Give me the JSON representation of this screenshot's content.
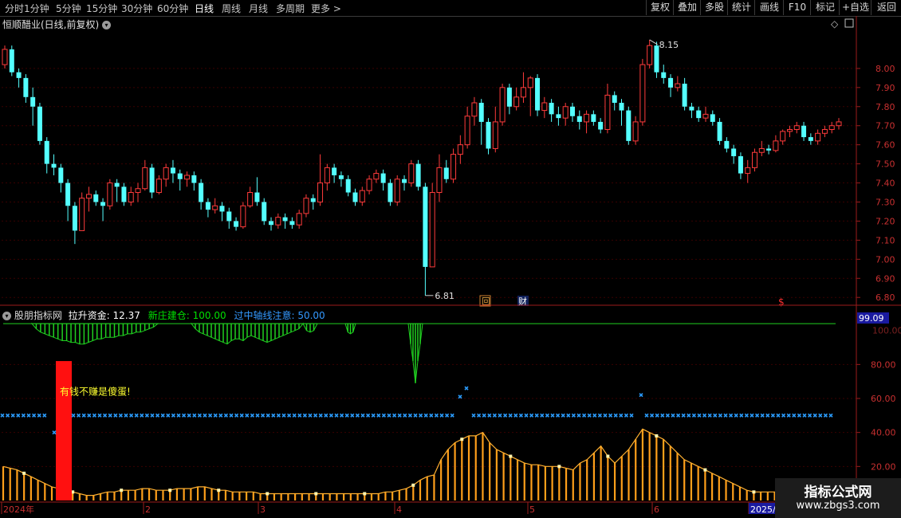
{
  "toolbar": {
    "periods": [
      "分时",
      "1分钟",
      "5分钟",
      "15分钟",
      "30分钟",
      "60分钟",
      "日线",
      "周线",
      "月线",
      "多周期",
      "更多"
    ],
    "active_period": "日线",
    "more_arrow": ">",
    "right_buttons": [
      "复权",
      "叠加",
      "多股",
      "统计",
      "画线",
      "F10",
      "标记",
      "+自选",
      "返回"
    ]
  },
  "stock": {
    "title": "恒顺醋业(日线,前复权)",
    "high_label": "8.15",
    "low_label": "6.81",
    "event_hui": "回",
    "event_cai": "财",
    "event_dollar": "$"
  },
  "indicator": {
    "name": "股朋指标网",
    "lift_label": "拉升资金:",
    "lift_value": "12.37",
    "new_label": "新庄建仓:",
    "new_value": "100.00",
    "mid_label": "过中轴线注意:",
    "mid_value": "50.00",
    "current_value_box": "99.09",
    "slogan": "有钱不赚是傻蛋!",
    "colors": {
      "lift": "#ffffff",
      "new": "#00e000",
      "mid": "#3399ff",
      "bars": "#ff9f1a"
    }
  },
  "main_axis": {
    "ticks": [
      "8.00",
      "7.90",
      "7.80",
      "7.70",
      "7.60",
      "7.50",
      "7.40",
      "7.30",
      "7.20",
      "7.10",
      "7.00",
      "6.90",
      "6.80"
    ]
  },
  "ind_axis": {
    "ticks": [
      "80.00",
      "60.00",
      "40.00",
      "20.00"
    ],
    "top_tick": "100.00"
  },
  "time_axis": {
    "labels": [
      "2024年",
      "2",
      "3",
      "4",
      "5",
      "6",
      "2025/"
    ]
  },
  "watermark": {
    "line1": "指标公式网",
    "line2": "www.zbgs3.com"
  },
  "chart_data": {
    "type": "candlestick",
    "price_range": [
      6.78,
      8.2
    ],
    "candles": [
      [
        8.02,
        8.1,
        8.12,
        8.0
      ],
      [
        8.1,
        7.98,
        8.12,
        7.96
      ],
      [
        7.98,
        7.95,
        8.0,
        7.9
      ],
      [
        7.95,
        7.85,
        7.97,
        7.82
      ],
      [
        7.85,
        7.8,
        7.9,
        7.7
      ],
      [
        7.8,
        7.62,
        7.82,
        7.6
      ],
      [
        7.62,
        7.5,
        7.64,
        7.45
      ],
      [
        7.5,
        7.48,
        7.55,
        7.44
      ],
      [
        7.48,
        7.4,
        7.5,
        7.35
      ],
      [
        7.4,
        7.28,
        7.42,
        7.2
      ],
      [
        7.28,
        7.15,
        7.3,
        7.08
      ],
      [
        7.15,
        7.32,
        7.35,
        7.15
      ],
      [
        7.32,
        7.34,
        7.38,
        7.25
      ],
      [
        7.34,
        7.3,
        7.36,
        7.28
      ],
      [
        7.3,
        7.28,
        7.32,
        7.2
      ],
      [
        7.28,
        7.4,
        7.42,
        7.26
      ],
      [
        7.4,
        7.38,
        7.42,
        7.3
      ],
      [
        7.38,
        7.3,
        7.4,
        7.28
      ],
      [
        7.3,
        7.35,
        7.38,
        7.28
      ],
      [
        7.35,
        7.37,
        7.4,
        7.3
      ],
      [
        7.37,
        7.48,
        7.52,
        7.36
      ],
      [
        7.48,
        7.35,
        7.5,
        7.32
      ],
      [
        7.35,
        7.42,
        7.44,
        7.34
      ],
      [
        7.42,
        7.48,
        7.5,
        7.38
      ],
      [
        7.48,
        7.45,
        7.52,
        7.4
      ],
      [
        7.45,
        7.42,
        7.47,
        7.36
      ],
      [
        7.42,
        7.44,
        7.46,
        7.38
      ],
      [
        7.44,
        7.4,
        7.46,
        7.36
      ],
      [
        7.4,
        7.3,
        7.42,
        7.26
      ],
      [
        7.3,
        7.26,
        7.32,
        7.22
      ],
      [
        7.26,
        7.28,
        7.32,
        7.24
      ],
      [
        7.28,
        7.25,
        7.3,
        7.2
      ],
      [
        7.25,
        7.2,
        7.27,
        7.16
      ],
      [
        7.2,
        7.17,
        7.22,
        7.15
      ],
      [
        7.17,
        7.28,
        7.3,
        7.16
      ],
      [
        7.28,
        7.35,
        7.38,
        7.27
      ],
      [
        7.35,
        7.3,
        7.43,
        7.28
      ],
      [
        7.3,
        7.2,
        7.32,
        7.18
      ],
      [
        7.2,
        7.18,
        7.22,
        7.15
      ],
      [
        7.18,
        7.22,
        7.24,
        7.16
      ],
      [
        7.22,
        7.2,
        7.24,
        7.16
      ],
      [
        7.2,
        7.18,
        7.22,
        7.16
      ],
      [
        7.18,
        7.24,
        7.26,
        7.16
      ],
      [
        7.24,
        7.32,
        7.34,
        7.22
      ],
      [
        7.32,
        7.3,
        7.34,
        7.26
      ],
      [
        7.3,
        7.4,
        7.55,
        7.28
      ],
      [
        7.4,
        7.48,
        7.5,
        7.36
      ],
      [
        7.48,
        7.44,
        7.5,
        7.4
      ],
      [
        7.44,
        7.42,
        7.46,
        7.38
      ],
      [
        7.42,
        7.35,
        7.44,
        7.33
      ],
      [
        7.35,
        7.3,
        7.37,
        7.28
      ],
      [
        7.3,
        7.36,
        7.38,
        7.28
      ],
      [
        7.36,
        7.42,
        7.44,
        7.34
      ],
      [
        7.42,
        7.45,
        7.47,
        7.4
      ],
      [
        7.45,
        7.4,
        7.47,
        7.36
      ],
      [
        7.4,
        7.3,
        7.42,
        7.28
      ],
      [
        7.3,
        7.42,
        7.44,
        7.28
      ],
      [
        7.42,
        7.4,
        7.44,
        7.36
      ],
      [
        7.4,
        7.5,
        7.52,
        7.38
      ],
      [
        7.5,
        7.38,
        7.52,
        7.36
      ],
      [
        7.38,
        6.96,
        7.4,
        6.81
      ],
      [
        6.96,
        7.35,
        7.4,
        6.96
      ],
      [
        7.35,
        7.48,
        7.55,
        7.3
      ],
      [
        7.48,
        7.42,
        7.52,
        7.4
      ],
      [
        7.42,
        7.55,
        7.58,
        7.4
      ],
      [
        7.55,
        7.6,
        7.65,
        7.5
      ],
      [
        7.6,
        7.75,
        7.8,
        7.58
      ],
      [
        7.75,
        7.82,
        7.85,
        7.7
      ],
      [
        7.82,
        7.72,
        7.84,
        7.6
      ],
      [
        7.72,
        7.58,
        7.74,
        7.55
      ],
      [
        7.58,
        7.72,
        7.8,
        7.56
      ],
      [
        7.72,
        7.9,
        7.92,
        7.7
      ],
      [
        7.9,
        7.8,
        7.92,
        7.76
      ],
      [
        7.8,
        7.85,
        7.9,
        7.78
      ],
      [
        7.85,
        7.9,
        7.98,
        7.82
      ],
      [
        7.9,
        7.95,
        7.96,
        7.75
      ],
      [
        7.95,
        7.78,
        7.97,
        7.75
      ],
      [
        7.78,
        7.82,
        7.85,
        7.74
      ],
      [
        7.82,
        7.76,
        7.84,
        7.72
      ],
      [
        7.76,
        7.74,
        7.8,
        7.7
      ],
      [
        7.74,
        7.8,
        7.82,
        7.7
      ],
      [
        7.8,
        7.75,
        7.82,
        7.72
      ],
      [
        7.75,
        7.72,
        7.78,
        7.68
      ],
      [
        7.72,
        7.76,
        7.78,
        7.66
      ],
      [
        7.76,
        7.72,
        7.78,
        7.7
      ],
      [
        7.72,
        7.68,
        7.74,
        7.66
      ],
      [
        7.68,
        7.86,
        7.92,
        7.66
      ],
      [
        7.86,
        7.82,
        7.88,
        7.78
      ],
      [
        7.82,
        7.78,
        7.84,
        7.7
      ],
      [
        7.78,
        7.62,
        7.8,
        7.6
      ],
      [
        7.62,
        7.72,
        7.75,
        7.6
      ],
      [
        7.72,
        8.02,
        8.05,
        7.7
      ],
      [
        8.02,
        8.12,
        8.15,
        8.0
      ],
      [
        8.12,
        7.98,
        8.14,
        7.95
      ],
      [
        7.98,
        7.95,
        8.02,
        7.92
      ],
      [
        7.95,
        7.9,
        7.97,
        7.85
      ],
      [
        7.9,
        7.92,
        7.96,
        7.88
      ],
      [
        7.92,
        7.8,
        7.95,
        7.78
      ],
      [
        7.8,
        7.78,
        7.82,
        7.74
      ],
      [
        7.78,
        7.74,
        7.8,
        7.72
      ],
      [
        7.74,
        7.76,
        7.8,
        7.72
      ],
      [
        7.76,
        7.72,
        7.78,
        7.7
      ],
      [
        7.72,
        7.62,
        7.74,
        7.6
      ],
      [
        7.62,
        7.58,
        7.64,
        7.56
      ],
      [
        7.58,
        7.54,
        7.6,
        7.5
      ],
      [
        7.54,
        7.45,
        7.56,
        7.42
      ],
      [
        7.45,
        7.48,
        7.52,
        7.4
      ],
      [
        7.48,
        7.56,
        7.58,
        7.46
      ],
      [
        7.56,
        7.58,
        7.62,
        7.54
      ],
      [
        7.58,
        7.57,
        7.6,
        7.55
      ],
      [
        7.57,
        7.62,
        7.65,
        7.56
      ],
      [
        7.62,
        7.67,
        7.68,
        7.6
      ],
      [
        7.67,
        7.68,
        7.7,
        7.64
      ],
      [
        7.68,
        7.7,
        7.72,
        7.66
      ],
      [
        7.7,
        7.64,
        7.72,
        7.62
      ],
      [
        7.64,
        7.62,
        7.66,
        7.6
      ],
      [
        7.62,
        7.66,
        7.68,
        7.6
      ],
      [
        7.66,
        7.68,
        7.7,
        7.64
      ],
      [
        7.68,
        7.7,
        7.72,
        7.66
      ],
      [
        7.7,
        7.72,
        7.74,
        7.68
      ]
    ],
    "indicator_range": [
      0,
      105
    ],
    "green_band": [
      [
        0,
        104,
        104,
        104,
        100,
        97,
        96,
        95,
        94,
        94,
        93,
        93,
        92,
        94,
        96,
        97,
        97,
        97,
        98,
        97,
        98,
        97,
        98,
        99,
        98,
        98,
        104,
        104
      ],
      [
        104,
        97,
        96,
        96,
        95,
        94,
        93,
        92,
        93,
        93,
        92,
        95,
        94,
        98,
        96,
        95,
        95,
        94,
        95,
        96,
        97,
        98,
        99,
        100,
        98,
        104,
        104,
        104,
        104
      ],
      [
        104,
        104,
        104,
        104,
        104,
        104,
        104,
        104,
        104,
        104,
        104,
        104,
        104,
        104,
        104,
        104,
        104,
        104,
        104,
        104,
        104,
        104,
        104,
        104,
        104,
        104,
        104,
        104,
        104,
        104,
        104,
        104,
        104,
        104,
        104,
        104,
        104,
        104,
        104,
        104,
        104,
        104,
        104,
        104,
        104,
        104,
        104,
        104,
        104,
        104,
        104,
        104,
        104,
        104,
        104,
        104,
        104,
        104,
        104,
        104,
        104,
        104,
        104
      ]
    ],
    "orange_values": [
      20,
      19,
      18,
      16,
      14,
      12,
      10,
      8,
      7,
      6,
      5,
      4,
      3,
      3,
      4,
      5,
      5,
      6,
      6,
      6,
      7,
      7,
      6,
      6,
      6,
      7,
      7,
      7,
      8,
      8,
      7,
      6,
      6,
      5,
      5,
      5,
      5,
      4,
      4,
      4,
      4,
      4,
      4,
      4,
      4,
      4,
      4,
      4,
      4,
      4,
      4,
      4,
      4,
      4,
      4,
      5,
      5,
      6,
      7,
      9,
      12,
      14,
      15,
      24,
      30,
      34,
      36,
      38,
      38,
      40,
      34,
      30,
      28,
      26,
      24,
      22,
      21,
      21,
      20,
      20,
      20,
      19,
      18,
      22,
      24,
      28,
      32,
      26,
      22,
      26,
      30,
      36,
      42,
      40,
      38,
      36,
      32,
      28,
      24,
      22,
      20,
      18,
      16,
      14,
      12,
      10,
      8,
      6,
      5,
      5,
      5,
      5,
      5,
      6,
      6,
      6,
      7,
      7,
      8,
      8,
      9
    ]
  }
}
